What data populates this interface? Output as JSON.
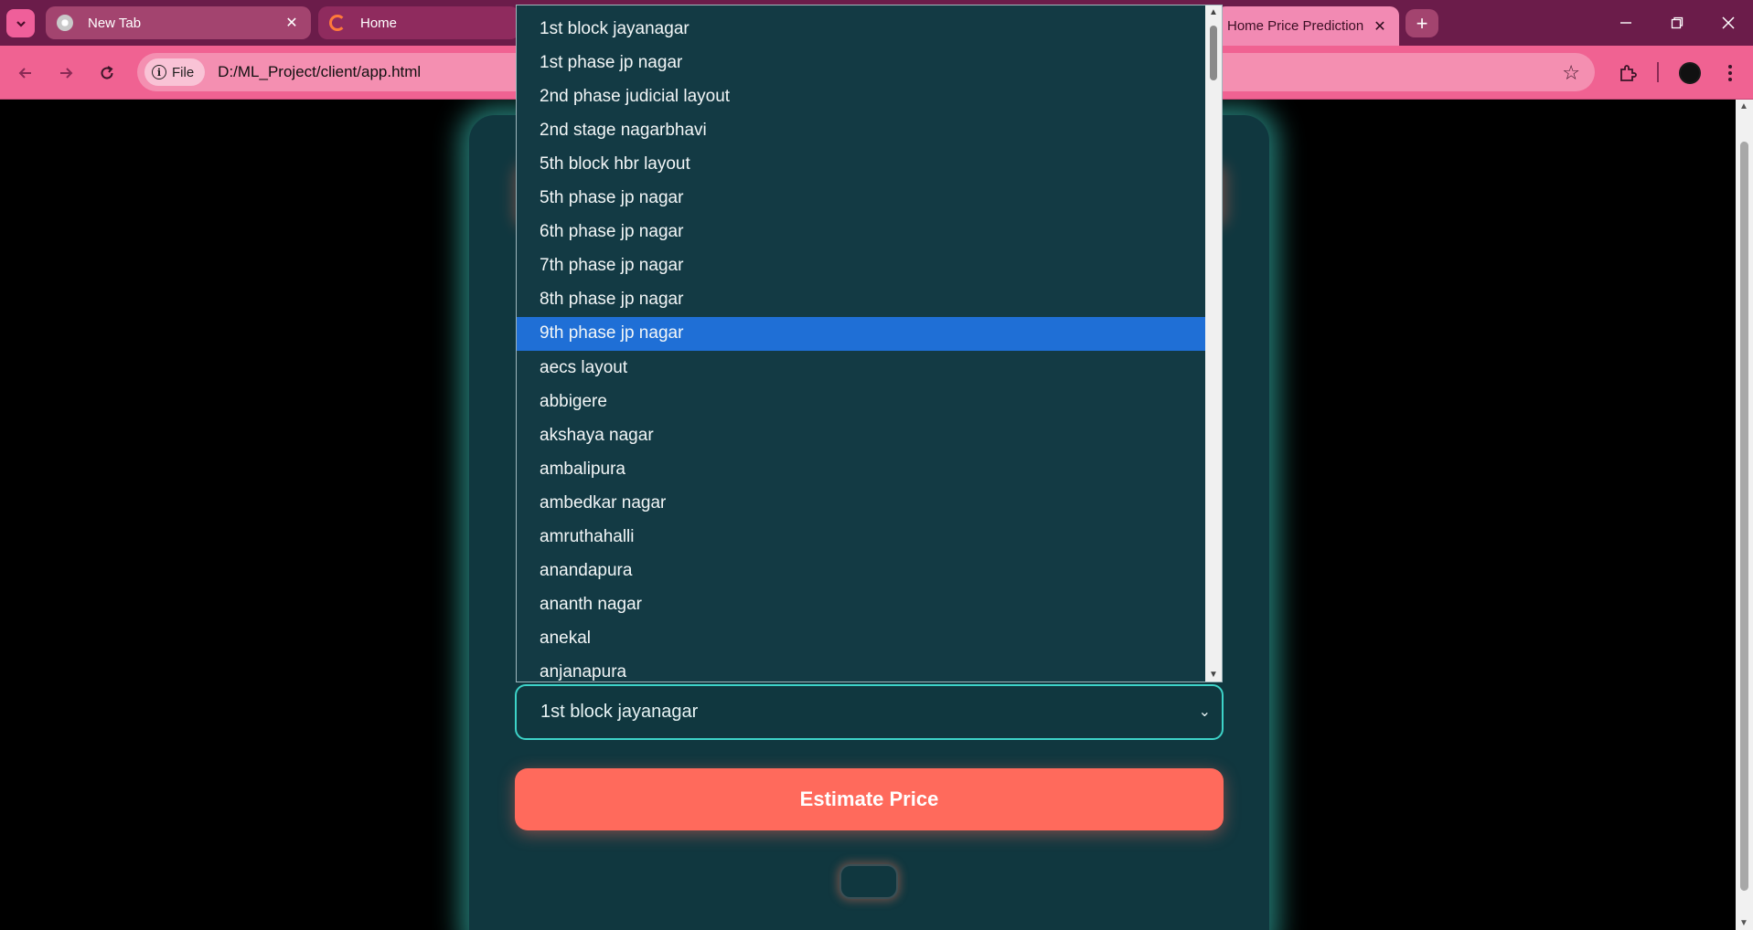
{
  "browser": {
    "tabs": [
      {
        "title": "New Tab"
      },
      {
        "title": "Home"
      },
      {
        "title": "Home Price Prediction"
      }
    ],
    "new_tab": "+",
    "address": {
      "chip_label": "File",
      "url": "D:/ML_Project/client/app.html"
    },
    "window_controls": {
      "minimize": "—",
      "restore": "❐",
      "close": "✕"
    }
  },
  "dropdown": {
    "options": [
      "1st block jayanagar",
      "1st phase jp nagar",
      "2nd phase judicial layout",
      "2nd stage nagarbhavi",
      "5th block hbr layout",
      "5th phase jp nagar",
      "6th phase jp nagar",
      "7th phase jp nagar",
      "8th phase jp nagar",
      "9th phase jp nagar",
      "aecs layout",
      "abbigere",
      "akshaya nagar",
      "ambalipura",
      "ambedkar nagar",
      "amruthahalli",
      "anandapura",
      "ananth nagar",
      "anekal",
      "anjanapura"
    ],
    "highlighted_index": 9,
    "highlight_color": "#1f6fd6"
  },
  "form": {
    "location_select": {
      "value": "1st block jayanagar"
    },
    "estimate_button": "Estimate Price"
  },
  "colors": {
    "tabstrip": "#6b1c4a",
    "toolbar": "#f06292",
    "card": "#10373f",
    "glow": "#40dcd2",
    "button": "#ff6a5c"
  }
}
